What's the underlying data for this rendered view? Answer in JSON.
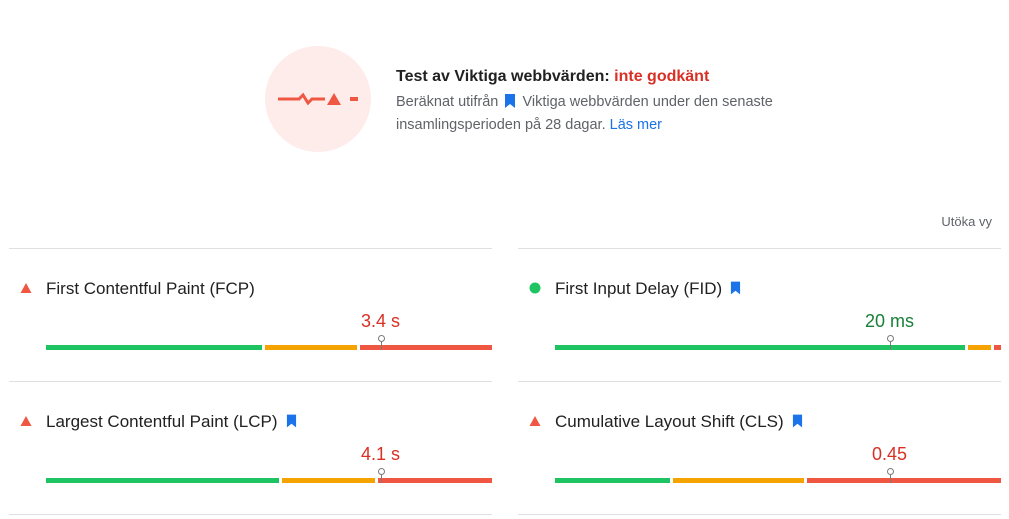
{
  "summary": {
    "title_prefix": "Test av Viktiga webbvärden: ",
    "title_status": "inte godkänt",
    "desc_before": "Beräknat utifrån",
    "desc_after": "Viktiga webbvärden under den senaste insamlingsperioden på 28 dagar.",
    "learn_more": "Läs mer",
    "status_color": "#d93025"
  },
  "expand_label": "Utöka vy",
  "colors": {
    "good": "#1ec462",
    "average": "#f5a300",
    "poor": "#f05742",
    "link": "#1a73e8"
  },
  "metrics": [
    {
      "label": "First Contentful Paint (FCP)",
      "value": "3.4 s",
      "rating": "poor",
      "status_icon": "triangle-warning-icon",
      "core_web_vital": false,
      "distribution": {
        "good": 0.49,
        "average": 0.215,
        "poor": 0.295
      },
      "marker": 0.75
    },
    {
      "label": "First Input Delay (FID)",
      "value": "20 ms",
      "rating": "good",
      "status_icon": "circle-pass-icon",
      "core_web_vital": true,
      "distribution": {
        "good": 0.925,
        "average": 0.06,
        "poor": 0.015
      },
      "marker": 0.75
    },
    {
      "label": "Largest Contentful Paint (LCP)",
      "value": "4.1 s",
      "rating": "poor",
      "status_icon": "triangle-warning-icon",
      "core_web_vital": true,
      "distribution": {
        "good": 0.53,
        "average": 0.215,
        "poor": 0.255
      },
      "marker": 0.75
    },
    {
      "label": "Cumulative Layout Shift (CLS)",
      "value": "0.45",
      "rating": "poor",
      "status_icon": "triangle-warning-icon",
      "core_web_vital": true,
      "distribution": {
        "good": 0.265,
        "average": 0.3,
        "poor": 0.435
      },
      "marker": 0.75
    }
  ]
}
